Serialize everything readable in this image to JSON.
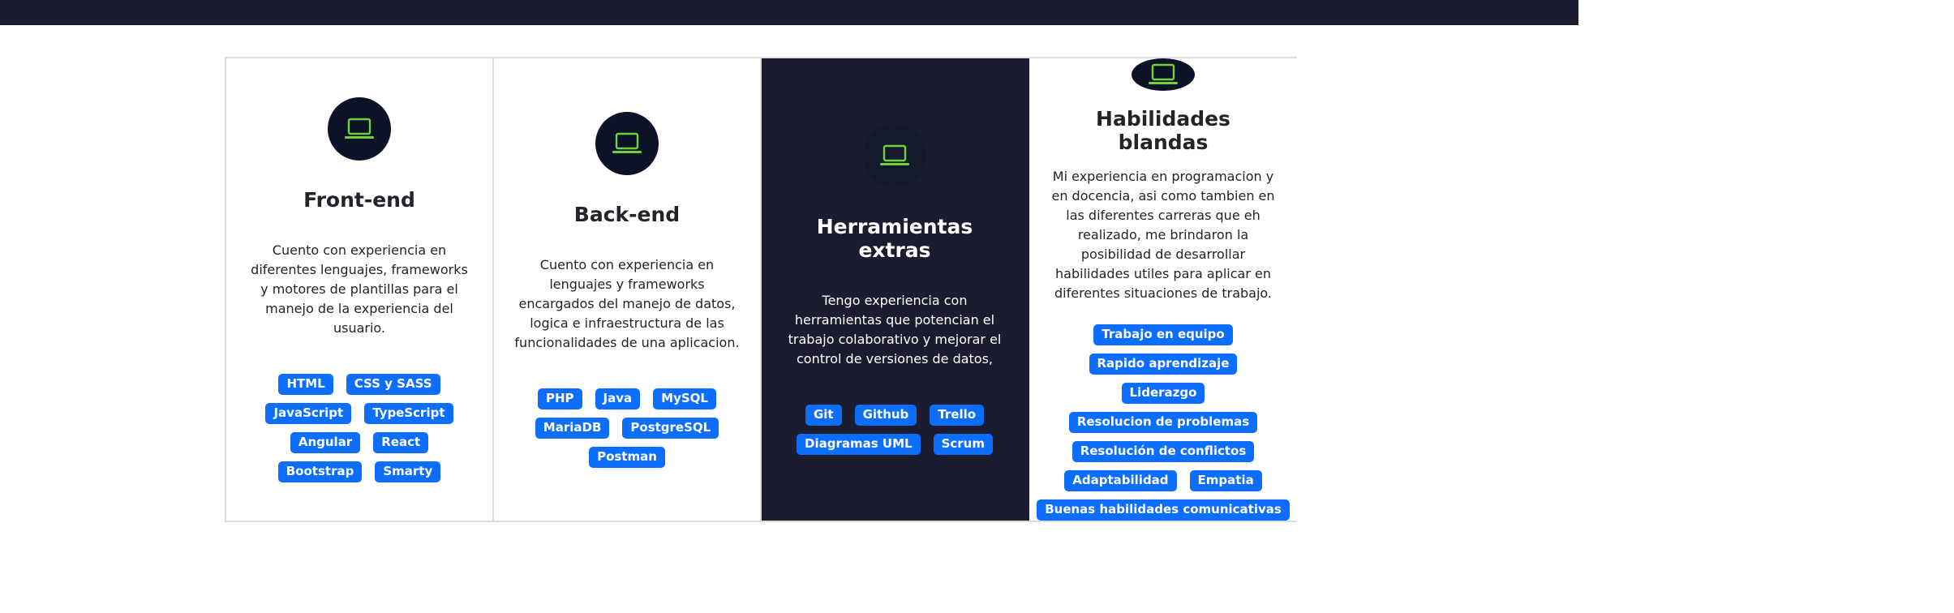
{
  "colors": {
    "navbar": "#1c1c30",
    "dark_card": "#1c1c30",
    "icon_circle": "#0c1327",
    "icon_green": "#6fd13b",
    "badge": "#0d6efd"
  },
  "cards": [
    {
      "icon": "laptop-icon",
      "title": "Front-end",
      "text": "Cuento con experiencia en diferentes lenguajes, frameworks y motores de plantillas para el manejo de la experiencia del usuario.",
      "badges": [
        "HTML",
        "CSS y SASS",
        "JavaScript",
        "TypeScript",
        "Angular",
        "React",
        "Bootstrap",
        "Smarty"
      ]
    },
    {
      "icon": "laptop-icon",
      "title": "Back-end",
      "text": "Cuento con experiencia en lenguajes y frameworks encargados del manejo de datos, logica e infraestructura de las funcionalidades de una aplicacion.",
      "badges": [
        "PHP",
        "Java",
        "MySQL",
        "MariaDB",
        "PostgreSQL",
        "Postman"
      ]
    },
    {
      "icon": "laptop-icon",
      "title": "Herramientas extras",
      "text": "Tengo experiencia con herramientas que potencian el trabajo colaborativo y mejorar el control de versiones de datos,",
      "badges": [
        "Git",
        "Github",
        "Trello",
        "Diagramas UML",
        "Scrum"
      ]
    },
    {
      "icon": "laptop-icon",
      "title": "Habilidades blandas",
      "text": "Mi experiencia en programacion y en docencia, asi como tambien en las diferentes carreras que eh realizado, me brindaron la posibilidad de desarrollar habilidades utiles para aplicar en diferentes situaciones de trabajo.",
      "badges": [
        "Trabajo en equipo",
        "Rapido aprendizaje",
        "Liderazgo",
        "Resolucion de problemas",
        "Resolución de conflictos",
        "Adaptabilidad",
        "Empatia",
        "Buenas habilidades comunicativas"
      ]
    }
  ]
}
